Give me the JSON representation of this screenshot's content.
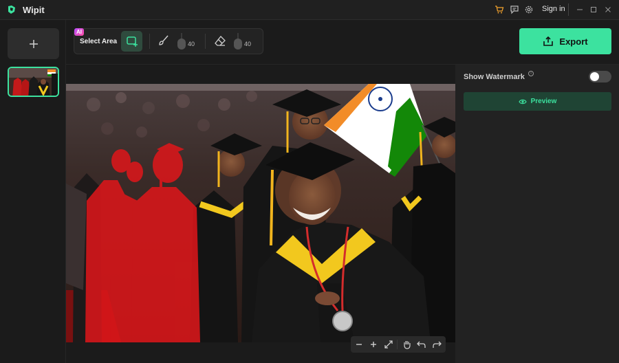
{
  "app": {
    "title": "Wipit"
  },
  "titlebar": {
    "signin_label": "Sign in"
  },
  "toolbar": {
    "ai_badge": "AI",
    "select_area_label": "Select Area",
    "brush_size": "40",
    "eraser_size": "40"
  },
  "export": {
    "label": "Export"
  },
  "right_panel": {
    "watermark_label": "Show Watermark",
    "info_glyph": "i",
    "watermark_on": false,
    "preview_label": "Preview"
  },
  "canvas": {
    "mask_color": "#e0161a",
    "accent": "#3ce29f"
  }
}
